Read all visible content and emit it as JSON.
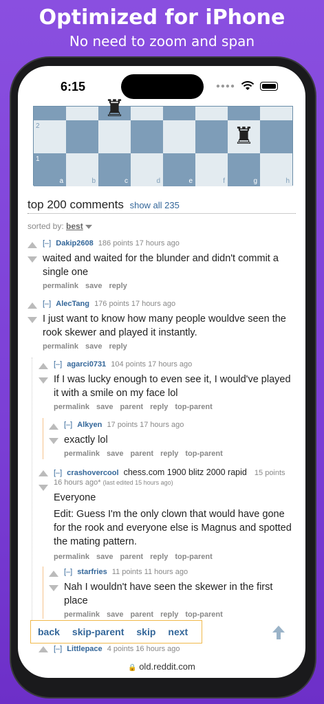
{
  "promo": {
    "title": "Optimized for iPhone",
    "subtitle": "No need to zoom and span"
  },
  "status": {
    "time": "6:15"
  },
  "board": {
    "files": [
      "a",
      "b",
      "c",
      "d",
      "e",
      "f",
      "g",
      "h"
    ],
    "ranks": [
      "2",
      "1"
    ],
    "pieces": [
      "black-rook",
      "black-rook"
    ]
  },
  "comments_header": {
    "title": "top 200 comments",
    "show_all": "show all 235"
  },
  "sort": {
    "label": "sorted by:",
    "value": "best"
  },
  "comments": [
    {
      "collapse": "[–]",
      "author": "Dakip2608",
      "meta": "186 points 17 hours ago",
      "body": "waited and waited for the blunder and didn't commit a single one",
      "links": [
        "permalink",
        "save",
        "reply"
      ]
    },
    {
      "collapse": "[–]",
      "author": "AlecTang",
      "meta": "176 points 17 hours ago",
      "body": "I just want to know how many people wouldve seen the rook skewer and played it instantly.",
      "links": [
        "permalink",
        "save",
        "reply"
      ]
    },
    {
      "collapse": "[–]",
      "author": "agarci0731",
      "meta": "104 points 17 hours ago",
      "body": "If I was lucky enough to even see it, I would've played it with a smile on my face lol",
      "links": [
        "permalink",
        "save",
        "parent",
        "reply",
        "top-parent"
      ]
    },
    {
      "collapse": "[–]",
      "author": "Alkyen",
      "meta": "17 points 17 hours ago",
      "body": "exactly lol",
      "links": [
        "permalink",
        "save",
        "parent",
        "reply",
        "top-parent"
      ]
    },
    {
      "collapse": "[–]",
      "author": "crashovercool",
      "flair": "chess.com 1900 blitz 2000 rapid",
      "meta": "15 points",
      "meta2": "16 hours ago*",
      "edited": "(last edited 15 hours ago)",
      "body": "Everyone",
      "body2": "Edit: Guess I'm the only clown that would have gone for the rook and everyone else is Magnus and spotted the mating pattern.",
      "links": [
        "permalink",
        "save",
        "parent",
        "reply",
        "top-parent"
      ]
    },
    {
      "collapse": "[–]",
      "author": "starfries",
      "meta": "11 points 11 hours ago",
      "body": "Nah I wouldn't have seen the skewer in the first place",
      "links": [
        "permalink",
        "save",
        "parent",
        "reply",
        "top-parent"
      ]
    },
    {
      "collapse": "[–]",
      "author": "Littlepace",
      "meta": "4 points 16 hours ago"
    }
  ],
  "nav": {
    "back": "back",
    "skip_parent": "skip-parent",
    "skip": "skip",
    "next": "next"
  },
  "url": "old.reddit.com"
}
